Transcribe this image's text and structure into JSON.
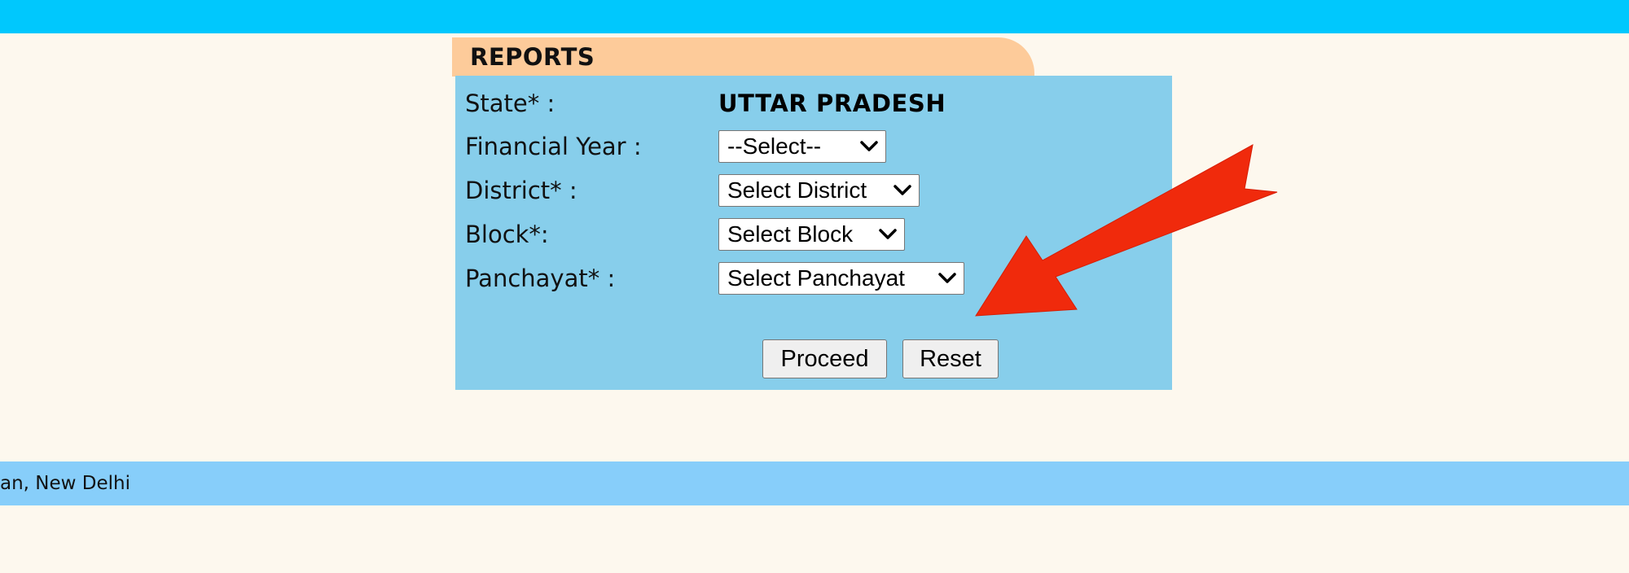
{
  "panel": {
    "title": "REPORTS"
  },
  "form": {
    "state_label": "State* :",
    "state_value": "UTTAR PRADESH",
    "financial_year_label": "Financial Year :",
    "financial_year_selected": "--Select--",
    "district_label": "District* :",
    "district_selected": "Select District",
    "block_label": "Block*:",
    "block_selected": "Select Block",
    "panchayat_label": "Panchayat* :",
    "panchayat_selected": "Select Panchayat"
  },
  "buttons": {
    "proceed": "Proceed",
    "reset": "Reset"
  },
  "footer": {
    "text": "an, New Delhi"
  },
  "colors": {
    "top_bar": "#00c8fd",
    "tab": "#fdcb9a",
    "panel": "#87ceeb",
    "footer": "#87cefa",
    "background": "#fdf8ee",
    "annotation_arrow": "#f02a0c"
  },
  "icons": {
    "dropdown": "chevron-down-icon",
    "annotation": "red-arrow-annotation"
  }
}
